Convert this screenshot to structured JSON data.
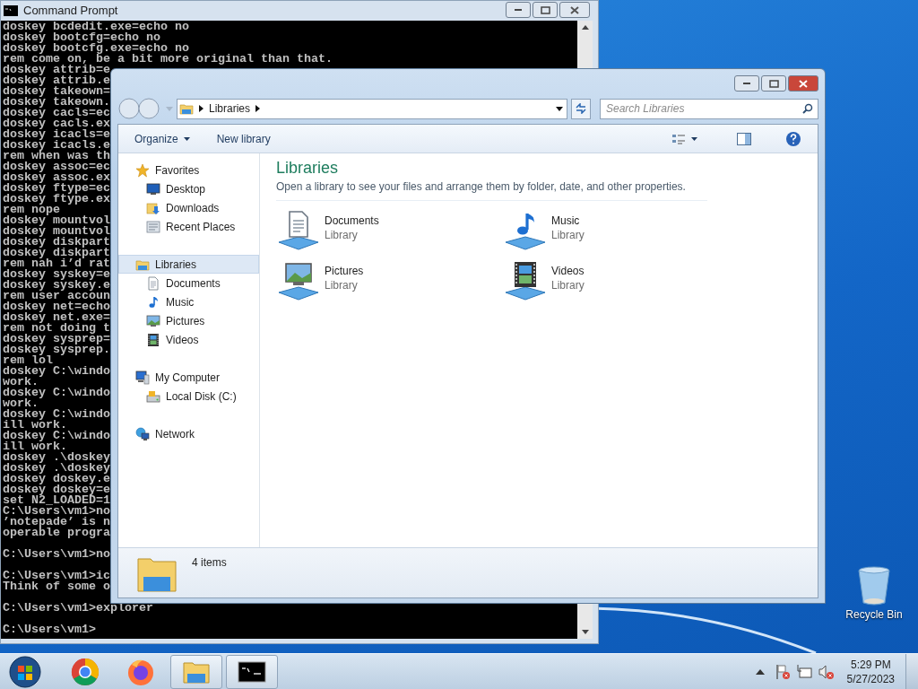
{
  "cmd_window": {
    "title": "Command Prompt",
    "blocks": [
      [
        "doskey bcdedit.exe=echo no",
        "doskey bootcfg=echo no",
        "doskey bootcfg.exe=echo no",
        "rem come on, be a bit more original than that.",
        "doskey attrib=e",
        "doskey attrib.e",
        "doskey takeown=",
        "doskey takeown.",
        "doskey cacls=ec",
        "doskey cacls.ex",
        "doskey icacls=e",
        "doskey icacls.e",
        "rem when was th",
        "doskey assoc=ec",
        "doskey assoc.ex",
        "doskey ftype=ec",
        "doskey ftype.ex",
        "rem nope",
        "doskey mountvol",
        "doskey mountvol",
        "doskey diskpart",
        "doskey diskpart",
        "rem nah i’d rat",
        "doskey syskey=e",
        "doskey syskey.e",
        "rem user accoun",
        "doskey net=echo",
        "doskey net.exe=",
        "rem not doing t",
        "doskey sysprep=",
        "doskey sysprep.",
        "rem lol",
        "doskey C:\\windo",
        "work.",
        "doskey C:\\windo",
        "work.",
        "doskey C:\\windo",
        "ill work.",
        "doskey C:\\windo",
        "ill work.",
        "doskey .\\doskey",
        "doskey .\\doskey",
        "doskey doskey.e",
        "doskey doskey=e",
        "set N2_LOADED=1",
        "C:\\Users\\vm1>no",
        "’notepade’ is n",
        "operable progra"
      ],
      [
        "C:\\Users\\vm1>no"
      ],
      [
        "C:\\Users\\vm1>ic",
        "Think of some o"
      ],
      [
        "C:\\Users\\vm1>explorer"
      ],
      [
        "C:\\Users\\vm1>"
      ]
    ]
  },
  "explorer": {
    "address": {
      "crumbs": [
        "Libraries"
      ]
    },
    "search": {
      "placeholder": "Search Libraries"
    },
    "toolbar": [
      {
        "label": "Organize",
        "dropdown": true
      },
      {
        "label": "New library",
        "dropdown": false
      }
    ],
    "nav": [
      {
        "label": "Favorites",
        "kind": "star",
        "selected": false,
        "children": [
          {
            "label": "Desktop",
            "kind": "desktop",
            "selected": false
          },
          {
            "label": "Downloads",
            "kind": "downloads",
            "selected": false
          },
          {
            "label": "Recent Places",
            "kind": "recent",
            "selected": false
          }
        ]
      },
      {
        "label": "Libraries",
        "kind": "library",
        "selected": true,
        "children": [
          {
            "label": "Documents",
            "kind": "documents",
            "selected": false
          },
          {
            "label": "Music",
            "kind": "music",
            "selected": false
          },
          {
            "label": "Pictures",
            "kind": "pictures",
            "selected": false
          },
          {
            "label": "Videos",
            "kind": "videos",
            "selected": false
          }
        ]
      },
      {
        "label": "My Computer",
        "kind": "computer",
        "selected": false,
        "children": [
          {
            "label": "Local Disk (C:)",
            "kind": "disk",
            "selected": false
          }
        ]
      },
      {
        "label": "Network",
        "kind": "network",
        "selected": false
      }
    ],
    "content": {
      "title": "Libraries",
      "description": "Open a library to see your files and arrange them by folder, date, and other properties.",
      "items": [
        {
          "name": "Documents",
          "type": "Library",
          "kind": "documents"
        },
        {
          "name": "Music",
          "type": "Library",
          "kind": "music"
        },
        {
          "name": "Pictures",
          "type": "Library",
          "kind": "pictures"
        },
        {
          "name": "Videos",
          "type": "Library",
          "kind": "videos"
        }
      ]
    },
    "details": {
      "count": "4 items"
    }
  },
  "desktop_icons": [
    {
      "label": "Recycle Bin"
    }
  ],
  "taskbar": {
    "apps": [
      {
        "kind": "chrome",
        "running": false
      },
      {
        "kind": "firefox",
        "running": false
      },
      {
        "kind": "explorer",
        "running": true
      },
      {
        "kind": "cmd",
        "running": true
      }
    ],
    "clock": {
      "time": "5:29 PM",
      "date": "5/27/2023"
    }
  }
}
